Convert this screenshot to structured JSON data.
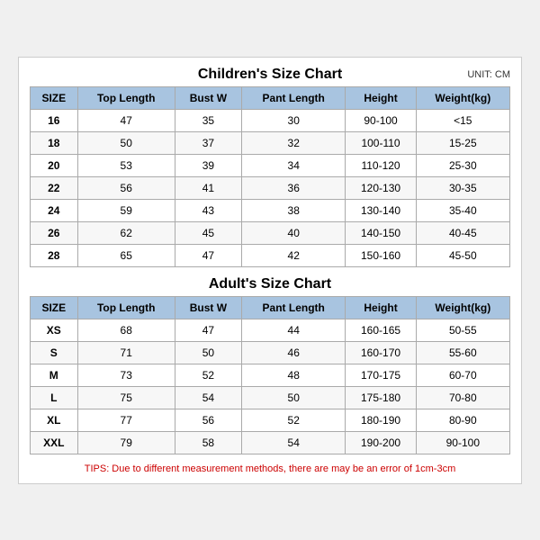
{
  "children": {
    "title": "Children's Size Chart",
    "unit": "UNIT: CM",
    "headers": [
      "SIZE",
      "Top Length",
      "Bust W",
      "Pant Length",
      "Height",
      "Weight(kg)"
    ],
    "rows": [
      [
        "16",
        "47",
        "35",
        "30",
        "90-100",
        "<15"
      ],
      [
        "18",
        "50",
        "37",
        "32",
        "100-110",
        "15-25"
      ],
      [
        "20",
        "53",
        "39",
        "34",
        "110-120",
        "25-30"
      ],
      [
        "22",
        "56",
        "41",
        "36",
        "120-130",
        "30-35"
      ],
      [
        "24",
        "59",
        "43",
        "38",
        "130-140",
        "35-40"
      ],
      [
        "26",
        "62",
        "45",
        "40",
        "140-150",
        "40-45"
      ],
      [
        "28",
        "65",
        "47",
        "42",
        "150-160",
        "45-50"
      ]
    ]
  },
  "adult": {
    "title": "Adult's Size Chart",
    "headers": [
      "SIZE",
      "Top Length",
      "Bust W",
      "Pant Length",
      "Height",
      "Weight(kg)"
    ],
    "rows": [
      [
        "XS",
        "68",
        "47",
        "44",
        "160-165",
        "50-55"
      ],
      [
        "S",
        "71",
        "50",
        "46",
        "160-170",
        "55-60"
      ],
      [
        "M",
        "73",
        "52",
        "48",
        "170-175",
        "60-70"
      ],
      [
        "L",
        "75",
        "54",
        "50",
        "175-180",
        "70-80"
      ],
      [
        "XL",
        "77",
        "56",
        "52",
        "180-190",
        "80-90"
      ],
      [
        "XXL",
        "79",
        "58",
        "54",
        "190-200",
        "90-100"
      ]
    ]
  },
  "tips": "TIPS: Due to different measurement methods, there are may be an error of 1cm-3cm"
}
